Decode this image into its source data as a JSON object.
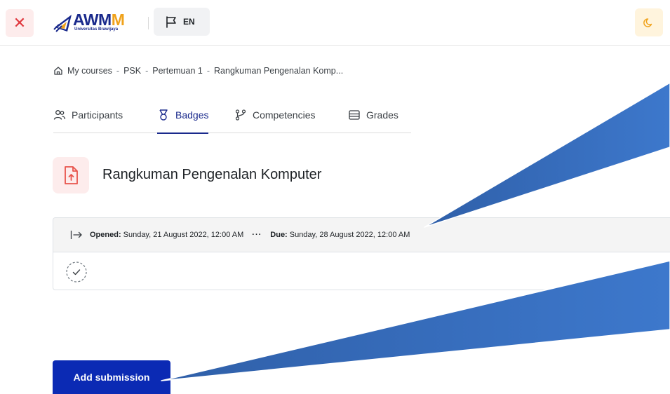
{
  "topbar": {
    "close_symbol": "✕",
    "logo": {
      "word_main": "AWM",
      "word_accent": "M",
      "subtitle": "Universitas Brawijaya"
    },
    "language_label": "EN",
    "icons": {
      "close": "close-icon",
      "flag": "flag-icon",
      "mode": "moon-icon"
    }
  },
  "breadcrumb": {
    "items": [
      "My courses",
      "PSK",
      "Pertemuan 1",
      "Rangkuman Pengenalan Komp..."
    ],
    "separator": "-"
  },
  "tabs": [
    {
      "label": "Participants",
      "icon": "participants-icon",
      "active": false
    },
    {
      "label": "Badges",
      "icon": "badge-icon",
      "active": true
    },
    {
      "label": "Competencies",
      "icon": "competencies-icon",
      "active": false
    },
    {
      "label": "Grades",
      "icon": "grades-icon",
      "active": false
    }
  ],
  "activity": {
    "title": "Rangkuman Pengenalan Komputer",
    "icon": "file-upload-icon"
  },
  "dates": {
    "opened_label": "Opened:",
    "opened_value": "Sunday, 21 August 2022, 12:00 AM",
    "separator": "···",
    "due_label": "Due:",
    "due_value": "Sunday, 28 August 2022, 12:00 AM"
  },
  "completion": {
    "icon": "completion-check-icon"
  },
  "actions": {
    "add_submission_label": "Add submission"
  },
  "colors": {
    "brand": "#1a2a8c",
    "accent": "#f0a21b",
    "primary_button": "#0b2ab4",
    "close_red": "#e0383e",
    "activity_icon_red": "#e8544c",
    "callout_blue": "#2f5fa8"
  }
}
